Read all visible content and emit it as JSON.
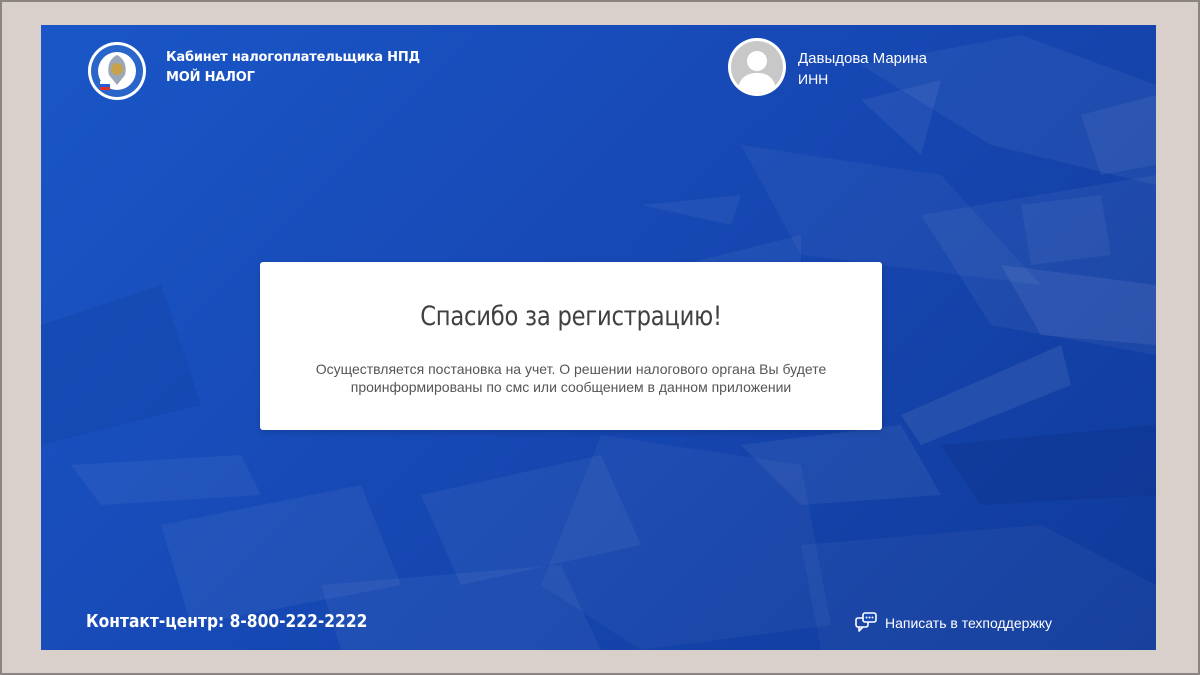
{
  "header": {
    "title_line1": "Кабинет налогоплательщика НПД",
    "title_line2": "МОЙ НАЛОГ",
    "logo_icon": "fns-emblem-icon"
  },
  "user": {
    "name": "Давыдова Марина",
    "inn_label": "ИНН",
    "avatar_icon": "user-avatar-icon"
  },
  "card": {
    "title": "Спасибо за регистрацию!",
    "text": "Осуществляется постановка на учет. О решении налогового органа Вы будете проинформированы по смс или сообщением в данном приложении"
  },
  "footer": {
    "contact": "Контакт-центр: 8-800-222-2222",
    "support_label": "Написать в техподдержку",
    "support_icon": "chat-bubbles-icon"
  },
  "colors": {
    "background_blue": "#1749b5",
    "card_bg": "#ffffff",
    "title_text": "#404040",
    "body_text": "#555555",
    "outer_frame": "#d9cfcb"
  }
}
